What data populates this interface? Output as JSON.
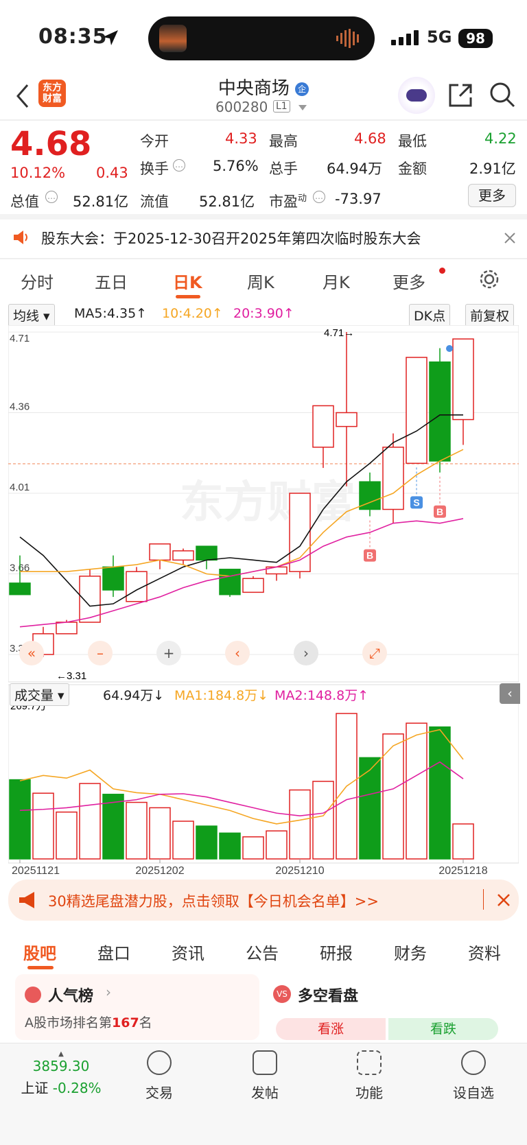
{
  "status": {
    "time": "08:35",
    "network": "5G",
    "battery": "98"
  },
  "header": {
    "logo_text": "东方财富",
    "title": "中央商场",
    "code": "600280",
    "level": "L1"
  },
  "quote": {
    "price": "4.68",
    "change_pct": "10.12%",
    "change": "0.43",
    "labels": {
      "open": "今开",
      "high": "最高",
      "low": "最低",
      "turnover": "换手",
      "volume": "总手",
      "amount": "金额",
      "mktcap": "总值",
      "float_cap": "流值",
      "pe": "市盈"
    },
    "pe_sup": "动",
    "values": {
      "open": "4.33",
      "high": "4.68",
      "low": "4.22",
      "turnover": "5.76%",
      "volume": "64.94万",
      "amount": "2.91亿",
      "mktcap": "52.81亿",
      "float_cap": "52.81亿",
      "pe": "-73.97"
    },
    "more": "更多"
  },
  "notice": {
    "text": "股东大会：于2025-12-30召开2025年第四次临时股东大会"
  },
  "chart_tabs": [
    "分时",
    "五日",
    "日K",
    "周K",
    "月K",
    "更多"
  ],
  "active_tab": "日K",
  "ma": {
    "select": "均线",
    "ma5": "MA5:4.35↑",
    "ma10": "10:4.20↑",
    "ma20": "20:3.90↑",
    "dk": "DK点",
    "fq": "前复权"
  },
  "vol": {
    "select": "成交量",
    "vol": "64.94万↓",
    "ma1": "MA1:184.8万↓",
    "ma2": "MA2:148.8万↑",
    "axis_max": "269.7万"
  },
  "colors": {
    "up": "#e02020",
    "down": "#0f9d1a",
    "ma5": "#111111",
    "ma10": "#f5a623",
    "ma20": "#e020a0"
  },
  "chart_data": {
    "type": "candlestick",
    "price_axis": [
      "4.71",
      "4.36",
      "4.01",
      "3.66",
      "3.31"
    ],
    "ylim": [
      3.31,
      4.71
    ],
    "max_label": "4.71→",
    "min_label": "←3.31",
    "dates": [
      "20251121",
      "20251202",
      "20251210",
      "20251218"
    ],
    "candles": [
      {
        "o": 3.62,
        "h": 3.74,
        "l": 3.61,
        "c": 3.57
      },
      {
        "o": 3.31,
        "h": 3.43,
        "l": 3.3,
        "c": 3.4
      },
      {
        "o": 3.4,
        "h": 3.46,
        "l": 3.4,
        "c": 3.45
      },
      {
        "o": 3.45,
        "h": 3.68,
        "l": 3.45,
        "c": 3.65
      },
      {
        "o": 3.69,
        "h": 3.74,
        "l": 3.56,
        "c": 3.59
      },
      {
        "o": 3.54,
        "h": 3.69,
        "l": 3.54,
        "c": 3.67
      },
      {
        "o": 3.72,
        "h": 3.79,
        "l": 3.68,
        "c": 3.79
      },
      {
        "o": 3.72,
        "h": 3.77,
        "l": 3.7,
        "c": 3.76
      },
      {
        "o": 3.78,
        "h": 3.78,
        "l": 3.68,
        "c": 3.72
      },
      {
        "o": 3.68,
        "h": 3.68,
        "l": 3.56,
        "c": 3.57
      },
      {
        "o": 3.58,
        "h": 3.65,
        "l": 3.58,
        "c": 3.64
      },
      {
        "o": 3.66,
        "h": 3.69,
        "l": 3.63,
        "c": 3.69
      },
      {
        "o": 3.67,
        "h": 4.01,
        "l": 3.64,
        "c": 4.01
      },
      {
        "o": 4.21,
        "h": 4.3,
        "l": 4.12,
        "c": 4.39
      },
      {
        "o": 4.3,
        "h": 4.71,
        "l": 4.04,
        "c": 4.36
      },
      {
        "o": 4.06,
        "h": 4.1,
        "l": 3.91,
        "c": 3.94
      },
      {
        "o": 3.94,
        "h": 4.27,
        "l": 3.88,
        "c": 4.21
      },
      {
        "o": 4.14,
        "h": 4.6,
        "l": 4.14,
        "c": 4.6
      },
      {
        "o": 4.58,
        "h": 4.64,
        "l": 4.1,
        "c": 4.15
      },
      {
        "o": 4.33,
        "h": 4.68,
        "l": 4.22,
        "c": 4.68
      }
    ],
    "ma5": [
      3.82,
      3.74,
      3.63,
      3.52,
      3.53,
      3.59,
      3.64,
      3.69,
      3.72,
      3.73,
      3.72,
      3.71,
      3.78,
      3.94,
      4.06,
      4.14,
      4.23,
      4.28,
      4.35,
      4.35
    ],
    "ma10": [
      3.67,
      3.67,
      3.67,
      3.68,
      3.69,
      3.7,
      3.72,
      3.7,
      3.66,
      3.65,
      3.67,
      3.69,
      3.73,
      3.84,
      3.93,
      3.97,
      4.01,
      4.09,
      4.15,
      4.2
    ],
    "ma20": [
      3.43,
      3.44,
      3.45,
      3.47,
      3.5,
      3.53,
      3.56,
      3.6,
      3.63,
      3.65,
      3.67,
      3.69,
      3.72,
      3.78,
      3.82,
      3.84,
      3.88,
      3.89,
      3.88,
      3.9
    ],
    "volume": [
      147,
      122,
      87,
      140,
      120,
      105,
      95,
      70,
      61,
      48,
      41,
      52,
      128,
      144,
      270,
      188,
      232,
      252,
      245,
      64.94
    ],
    "vol_ma1": [
      145,
      155,
      150,
      165,
      130,
      123,
      120,
      110,
      100,
      90,
      75,
      65,
      72,
      80,
      135,
      165,
      210,
      230,
      240,
      184.8
    ],
    "vol_ma2": [
      90,
      92,
      95,
      100,
      105,
      110,
      120,
      121,
      115,
      105,
      95,
      85,
      80,
      85,
      110,
      120,
      130,
      155,
      180,
      148.8
    ],
    "signals": [
      {
        "idx": 15,
        "type": "B"
      },
      {
        "idx": 17,
        "type": "S"
      },
      {
        "idx": 18,
        "type": "B"
      }
    ]
  },
  "banner": {
    "text": "30精选尾盘潜力股，点击领取【今日机会名单】>>"
  },
  "bottom_tabs": [
    "股吧",
    "盘口",
    "资讯",
    "公告",
    "研报",
    "财务",
    "资料"
  ],
  "cards": {
    "popular_title": "人气榜",
    "popular_rank_text": "A股市场排名第",
    "popular_rank": "167",
    "popular_unit": "名",
    "vs_title": "多空看盘",
    "bull": "看涨",
    "bear": "看跌"
  },
  "index": {
    "value": "3859.30",
    "name": "上证",
    "change": "-0.28%"
  },
  "nav": [
    "交易",
    "发帖",
    "功能",
    "设自选"
  ]
}
